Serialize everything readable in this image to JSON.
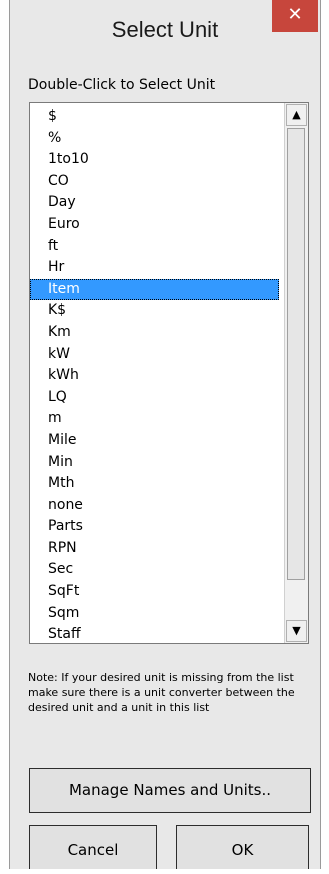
{
  "window": {
    "title": "Select Unit",
    "close_label": "✕"
  },
  "list": {
    "instruction": "Double-Click to Select Unit",
    "items": [
      "$",
      "%",
      "1to10",
      "CO",
      "Day",
      "Euro",
      "ft",
      "Hr",
      "Item",
      "K$",
      "Km",
      "kW",
      "kWh",
      "LQ",
      "m",
      "Mile",
      "Min",
      "Mth",
      "none",
      "Parts",
      "RPN",
      "Sec",
      "SqFt",
      "Sqm",
      "Staff"
    ],
    "selected_index": 8,
    "scroll_up_icon": "up-arrow",
    "scroll_down_icon": "down-arrow"
  },
  "note": "Note: If your desired unit is missing from the list make sure there is a unit converter between the desired unit and a unit in this list",
  "buttons": {
    "manage": "Manage Names and Units..",
    "cancel": "Cancel",
    "ok": "OK"
  },
  "colors": {
    "selection": "#3399ff",
    "close_button": "#c7463c"
  }
}
